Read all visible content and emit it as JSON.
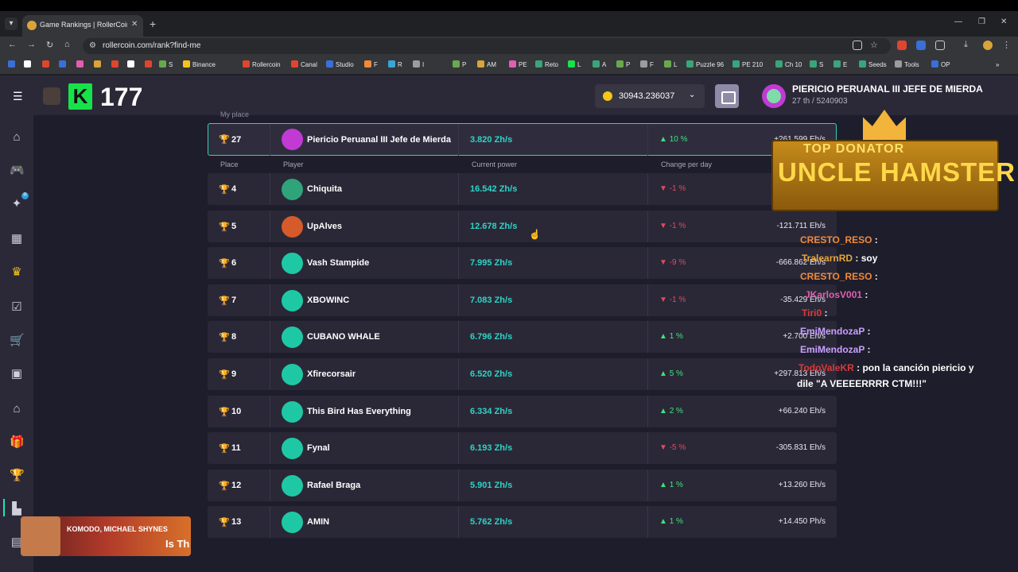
{
  "browser": {
    "tab_title": "Game Rankings | RollerCoin.com",
    "url": "rollercoin.com/rank?find-me",
    "bookmarks": [
      "S",
      "Binance",
      "Rollercoin",
      "Canal",
      "Studio",
      "F",
      "R",
      "I",
      "P",
      "AM",
      "PE",
      "Reto",
      "L",
      "A",
      "P",
      "F",
      "L",
      "Puzzle 96",
      "PE 210",
      "Ch 10",
      "S",
      "E",
      "Seeds",
      "Tools",
      "OP"
    ]
  },
  "header": {
    "k_count": "177",
    "balance": "30943.236037",
    "user_name": "PIERICIO PERUANAL III JEFE DE MIERDA",
    "user_rank": "27 th / 5240903"
  },
  "table": {
    "my_place_label": "My place",
    "my_row": {
      "place": "27",
      "player": "Piericio Peruanal III Jefe de Mierda",
      "power": "3.820 Zh/s",
      "change": "10 %",
      "delta": "+261.599 Eh/s"
    },
    "columns": {
      "place": "Place",
      "player": "Player",
      "power": "Current power",
      "change": "Change per day"
    },
    "rows": [
      {
        "place": "4",
        "player": "Chiquita",
        "power": "16.542 Zh/s",
        "change": "-1 %",
        "dir": "down",
        "delta": ""
      },
      {
        "place": "5",
        "player": "UpAlves",
        "power": "12.678 Zh/s",
        "change": "-1 %",
        "dir": "down",
        "delta": "-121.711 Eh/s"
      },
      {
        "place": "6",
        "player": "Vash Stampide",
        "power": "7.995 Zh/s",
        "change": "-9 %",
        "dir": "down",
        "delta": "-666.862 Eh/s"
      },
      {
        "place": "7",
        "player": "XBOWINC",
        "power": "7.083 Zh/s",
        "change": "-1 %",
        "dir": "down",
        "delta": "-35.429 Eh/s"
      },
      {
        "place": "8",
        "player": "CUBANO WHALE",
        "power": "6.796 Zh/s",
        "change": "1 %",
        "dir": "up",
        "delta": "+2.700 Eh/s"
      },
      {
        "place": "9",
        "player": "Xfirecorsair",
        "power": "6.520 Zh/s",
        "change": "5 %",
        "dir": "up",
        "delta": "+297.813 Eh/s"
      },
      {
        "place": "10",
        "player": "This Bird Has Everything",
        "power": "6.334 Zh/s",
        "change": "2 %",
        "dir": "up",
        "delta": "+66.240 Eh/s"
      },
      {
        "place": "11",
        "player": "Fynal",
        "power": "6.193 Zh/s",
        "change": "-5 %",
        "dir": "down",
        "delta": "-305.831 Eh/s"
      },
      {
        "place": "12",
        "player": "Rafael Braga",
        "power": "5.901 Zh/s",
        "change": "1 %",
        "dir": "up",
        "delta": "+13.260 Eh/s"
      },
      {
        "place": "13",
        "player": "AMIN",
        "power": "5.762 Zh/s",
        "change": "1 %",
        "dir": "up",
        "delta": "+14.450 Ph/s"
      }
    ]
  },
  "overlay": {
    "donator_line1": "TOP DONATOR",
    "donator_line2": "UNCLE HAMSTER",
    "chat": [
      {
        "user": "CRESTO_RESO",
        "color": "#f08a3a",
        "msg": ""
      },
      {
        "user": "TralearnRD",
        "color": "#e6a53d",
        "msg": "soy"
      },
      {
        "user": "CRESTO_RESO",
        "color": "#f08a3a",
        "msg": ""
      },
      {
        "user": "JKarlosV001",
        "color": "#e05fb0",
        "msg": ""
      },
      {
        "user": "Tiri0",
        "color": "#d83a3a",
        "msg": ""
      },
      {
        "user": "EmiMendozaP",
        "color": "#c8a0ff",
        "msg": ""
      },
      {
        "user": "EmiMendozaP",
        "color": "#c8a0ff",
        "msg": ""
      },
      {
        "user": "TodoValeKR",
        "color": "#d83a3a",
        "msg": "pon la canción piericio y"
      },
      {
        "user": "",
        "color": "#ffffff",
        "msg": "dile \"A VEEEERRRR CTM!!!\""
      }
    ],
    "music_artist": "KOMODO, MICHAEL SHYNES",
    "music_song": "Is Th"
  }
}
